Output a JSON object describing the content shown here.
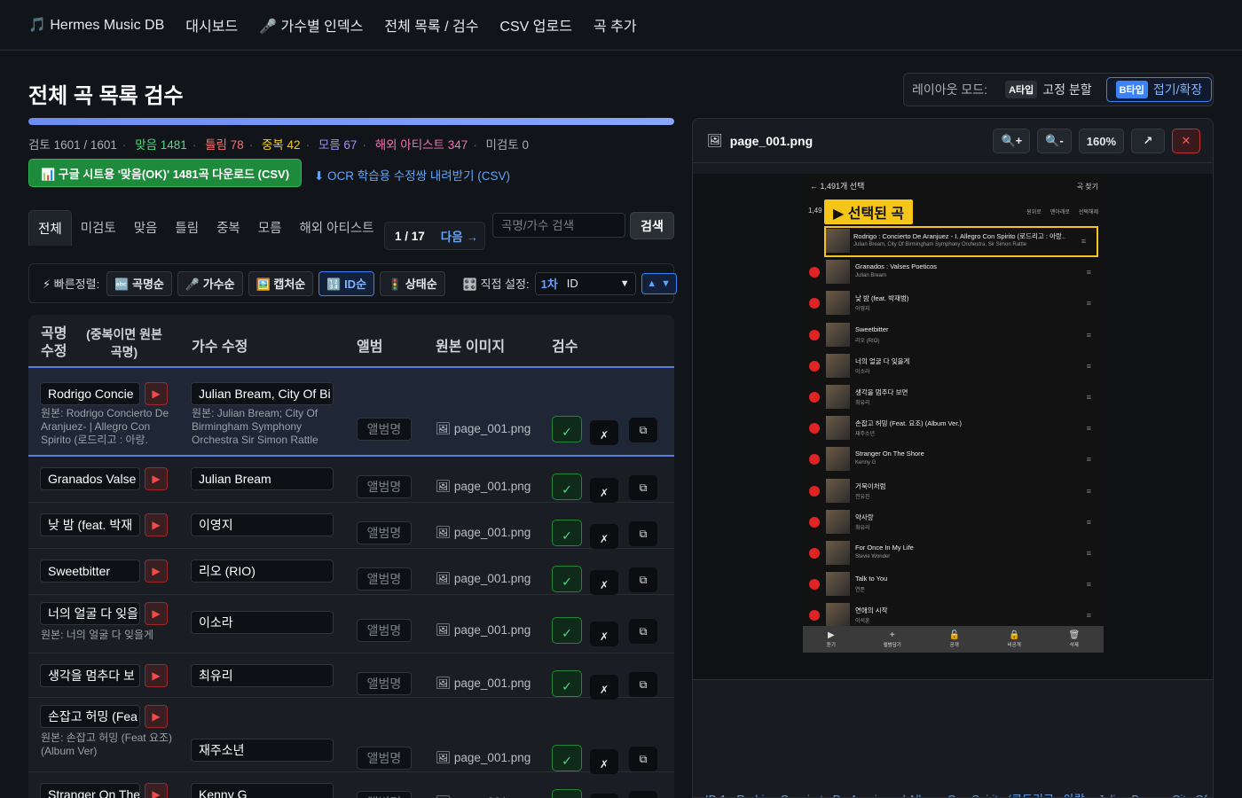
{
  "nav": {
    "brand": "🎵 Hermes Music DB",
    "items": [
      "대시보드",
      "🎤 가수별 인덱스",
      "전체 목록 / 검수",
      "CSV 업로드",
      "곡 추가"
    ]
  },
  "page_title": "전체 곡 목록 검수",
  "layout_mode": {
    "label": "레이아웃 모드:",
    "a_tag": "A타입",
    "a_label": "고정 분할",
    "b_tag": "B타입",
    "b_label": "접기/확장"
  },
  "progress": {
    "fraction": 1.0
  },
  "stats": {
    "reviewed": "검토 1601 / 1601",
    "ok": "맞음 1481",
    "wrong": "틀림 78",
    "dup": "중복 42",
    "unknown": "모름 67",
    "overseas": "해외 아티스트 347",
    "unreviewed": "미검토 0"
  },
  "download_btn": "📊 구글 시트용 '맞음(OK)' 1481곡 다운로드 (CSV)",
  "ocr_link": "⬇ OCR 학습용 수정쌍 내려받기 (CSV)",
  "filter_tabs": [
    "전체",
    "미검토",
    "맞음",
    "틀림",
    "중복",
    "모름",
    "해외 아티스트"
  ],
  "pager": {
    "page": "1 / 17",
    "next": "다음 →"
  },
  "search": {
    "placeholder": "곡명/가수 검색",
    "button": "검색"
  },
  "sortbar": {
    "label": "⚡ 빠른정렬:",
    "buttons": [
      "🔤 곡명순",
      "🎤 가수순",
      "🖼️ 캡처순",
      "🔢 ID순",
      "🚦 상태순"
    ],
    "direct_label": "🎛️ 직접 설정:",
    "select_first": "1차",
    "select_value": "ID",
    "dir": "▲"
  },
  "table": {
    "headers": {
      "title": "곡명 수정",
      "orig": "(중복이면 원본 곡명)",
      "artist": "가수 수정",
      "album": "앨범",
      "image": "원본 이미지",
      "review": "검수"
    },
    "album_placeholder": "앨범명",
    "rows": [
      {
        "title": "Rodrigo Concie",
        "orig_title": "원본: Rodrigo Concierto De Aranjuez- | Allegro Con Spirito (로드리고 : 아랑.",
        "artist": "Julian Bream, City Of Bi",
        "orig_artist": "원본: Julian Bream; City Of Birmingham Symphony Orchestra Sir Simon Rattle",
        "image": "🖼 page_001.png"
      },
      {
        "title": "Granados Valse",
        "orig_title": "",
        "artist": "Julian Bream",
        "orig_artist": "",
        "image": "🖼 page_001.png"
      },
      {
        "title": "낮 밤 (feat. 박재",
        "orig_title": "",
        "artist": "이영지",
        "orig_artist": "",
        "image": "🖼 page_001.png"
      },
      {
        "title": "Sweetbitter",
        "orig_title": "",
        "artist": "리오 (RIO)",
        "orig_artist": "",
        "image": "🖼 page_001.png"
      },
      {
        "title": "너의 얼굴 다 잊을",
        "orig_title": "원본: 너의 얼굴 다 잊을게",
        "artist": "이소라",
        "orig_artist": "",
        "image": "🖼 page_001.png"
      },
      {
        "title": "생각을 멈추다 보",
        "orig_title": "",
        "artist": "최유리",
        "orig_artist": "",
        "image": "🖼 page_001.png"
      },
      {
        "title": "손잡고 허밍 (Fea",
        "orig_title": "원본: 손잡고 허밍 (Feat 요조) (Album Ver)",
        "artist": "재주소년",
        "orig_artist": "",
        "image": "🖼 page_001.png"
      },
      {
        "title": "Stranger On The",
        "orig_title": "",
        "artist": "Kenny G",
        "orig_artist": "",
        "image": "🖼 page_001.png"
      }
    ],
    "ok_icon": "✓",
    "x_icon": "✗",
    "copy_icon": "⧉"
  },
  "preview": {
    "title": "page_001.png",
    "zoom_in": "🔍+",
    "zoom_out": "🔍-",
    "zoom": "160%",
    "open": "↗",
    "close": "✕",
    "caption": "ID 1 · Rodrigo Concierto De Aranjuez- | Allegro Con Spirito (로드리고 : 아랑. · Julian Bream, City Of",
    "phone": {
      "top": "←   1,491개 선택",
      "find": "곡 찾기",
      "count": "1,49",
      "badge": "▶ 선택된 곡",
      "sorts": [
        "원위로",
        "맨아래로",
        "선택해제"
      ],
      "rows": [
        {
          "t1": "Rodrigo : Concierto De Aranjuez - I. Allegro Con Spirito (로드리고 : 아랑..",
          "t2": "Julian Bream, City Of Birmingham Symphony Orchestra, Sir Simon Rattle"
        },
        {
          "t1": "Granados : Valses Poeticos",
          "t2": "Julian Bream"
        },
        {
          "t1": "낮 밤 (feat. 박재범)",
          "t2": "이영지"
        },
        {
          "t1": "Sweetbitter",
          "t2": "리오 (RIO)"
        },
        {
          "t1": "너의 얼굴 다 잊을게",
          "t2": "이소라"
        },
        {
          "t1": "생각을 멈추다 보면",
          "t2": "최유리"
        },
        {
          "t1": "손잡고 허밍 (Feat. 요조) (Album Ver.)",
          "t2": "재주소년"
        },
        {
          "t1": "Stranger On The Shore",
          "t2": "Kenny G"
        },
        {
          "t1": "거북이처럼",
          "t2": "전유진"
        },
        {
          "t1": "약사랑",
          "t2": "최유리"
        },
        {
          "t1": "For Once In My Life",
          "t2": "Stevie Wonder"
        },
        {
          "t1": "Talk to You",
          "t2": "연준"
        },
        {
          "t1": "연애의 시작",
          "t2": "이석훈"
        }
      ],
      "bar": [
        {
          "i": "▶",
          "l": "듣기"
        },
        {
          "i": "+",
          "l": "앨범담기"
        },
        {
          "i": "🔓",
          "l": "공개"
        },
        {
          "i": "🔒",
          "l": "비공개"
        },
        {
          "i": "🗑",
          "l": "삭제"
        }
      ]
    }
  },
  "colors": {
    "accent": "#3b82f6",
    "ok": "#4ade80",
    "wrong": "#f87171",
    "dup": "#facc15",
    "unknown": "#a78bfa",
    "overseas": "#f472b6",
    "badge": "#f5c518"
  }
}
